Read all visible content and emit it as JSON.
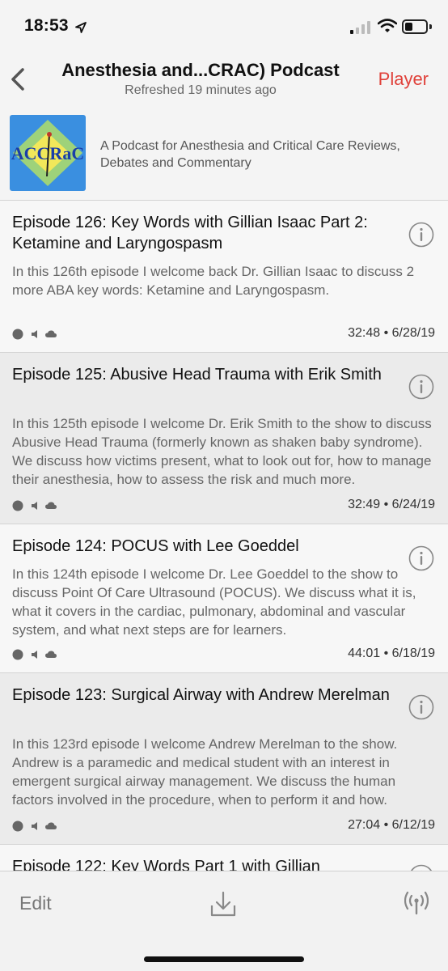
{
  "status_bar": {
    "time": "18:53"
  },
  "nav": {
    "title": "Anesthesia and...CRAC) Podcast",
    "subtitle": "Refreshed 19 minutes ago",
    "player_label": "Player"
  },
  "podcast": {
    "artwork_text": "ACCRaC",
    "description": "A Podcast for Anesthesia and Critical Care Reviews, Debates and Commentary"
  },
  "episodes": [
    {
      "title": "Episode 126: Key Words with Gillian Isaac Part 2: Ketamine and Laryngospasm",
      "description": "In this 126th episode I welcome back Dr. Gillian Isaac to discuss 2 more ABA key words: Ketamine and Laryngospasm.",
      "meta": "32:48 • 6/28/19"
    },
    {
      "title": "Episode 125: Abusive Head Trauma with Erik Smith",
      "description": "In this 125th episode I welcome Dr. Erik Smith to the show to discuss Abusive Head Trauma (formerly known as shaken baby syndrome). We discuss how victims present, what to look out for, how to manage their anesthesia, how to assess the risk and much more.",
      "meta": "32:49 • 6/24/19"
    },
    {
      "title": "Episode 124: POCUS with Lee Goeddel",
      "description": "In this 124th episode I welcome Dr. Lee Goeddel to the show to discuss Point Of Care Ultrasound (POCUS). We discuss what it is, what it covers in the cardiac, pulmonary, abdominal and vascular system, and what next steps are for learners.",
      "meta": "44:01 • 6/18/19"
    },
    {
      "title": "Episode 123: Surgical Airway with Andrew Merelman",
      "description": "In this 123rd episode I welcome Andrew Merelman to the show. Andrew is a paramedic and medical student with an interest in emergent surgical airway management. We discuss the human factors involved in the procedure, when to perform it and how.",
      "meta": "27:04 • 6/12/19"
    },
    {
      "title": "Episode 122: Key Words Part 1 with Gillian",
      "description": "",
      "meta": ""
    }
  ],
  "toolbar": {
    "edit_label": "Edit"
  },
  "icons": {
    "back": "chevron-left-icon",
    "info": "info-circle-icon",
    "played_status": "dot-icon",
    "audio": "speaker-icon",
    "cloud": "cloud-icon",
    "download": "download-icon",
    "station": "antenna-icon"
  },
  "colors": {
    "accent": "#e0413a",
    "row_shaded": "#ebebeb",
    "row_plain": "#f7f7f7"
  }
}
